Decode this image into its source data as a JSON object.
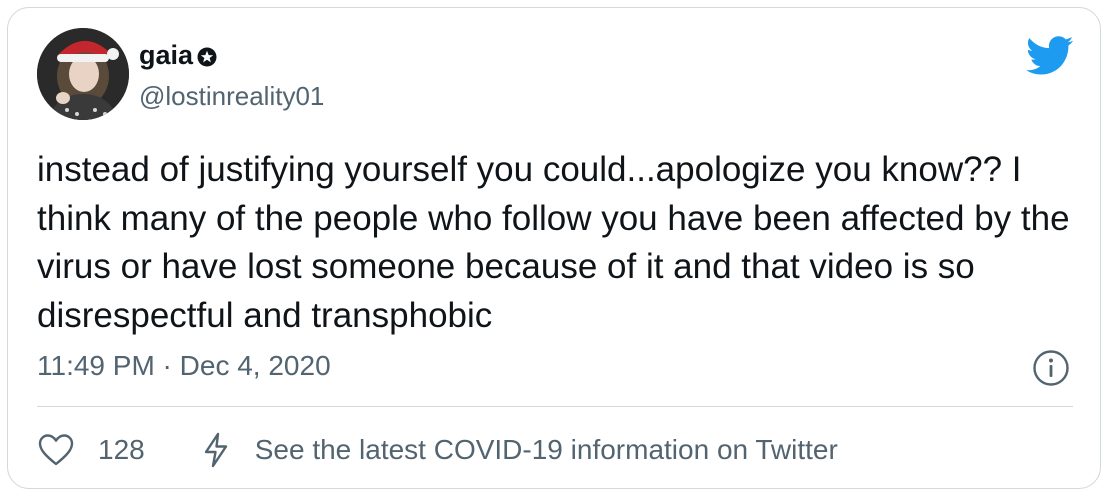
{
  "author": {
    "display_name": "gaia",
    "handle": "@lostinreality01",
    "avatar_icon": "profile-photo-santa-hat",
    "badge_icon": "star-badge-icon"
  },
  "tweet": {
    "text": "instead of justifying yourself you could...apologize you know?? I think many of the people who follow you have been affected by the virus or have lost someone because of it and that video is so disrespectful and transphobic",
    "timestamp": "11:49 PM · Dec 4, 2020"
  },
  "actions": {
    "like_count": "128",
    "covid_link": "See the latest COVID-19 information on Twitter"
  },
  "colors": {
    "brand_blue": "#1d9bf0",
    "text_primary": "#0f1419",
    "text_secondary": "#536471",
    "border": "#cfd9de"
  },
  "icons": {
    "logo": "twitter-bird-icon",
    "info": "info-icon",
    "like": "heart-icon",
    "covid": "lightning-bolt-icon"
  }
}
